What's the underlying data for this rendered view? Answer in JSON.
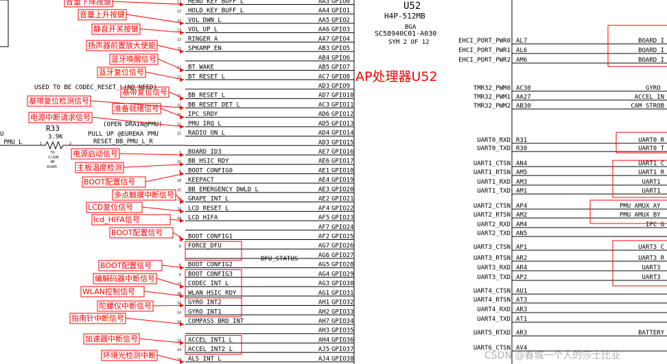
{
  "chip": {
    "ref": "U52",
    "part": "H4P-512MB",
    "package": "BGA",
    "number": "SC58940C01-A030",
    "sym": "SYM 2 OF 12",
    "title_annotation": "AP处理器U52"
  },
  "misc": {
    "used_note": "USED TO BE CODEC_RESET_L(NO NEED)",
    "open_drain": "(OPEN DRAIN@PMU)",
    "pull_up": "PULL UP @EUREKA PMU",
    "reset_net": "RESET_BB_PMU_L_R",
    "dfu_status": "DFU_STATUS",
    "left_u": "U",
    "left_net": "_PMU_L",
    "watermark": "CSDN @春城一个人的莎士比亚"
  },
  "resistor": {
    "ref": "R33",
    "value": "3.9K",
    "tol": "5%",
    "power": "1/32W",
    "type": "MF",
    "pkg": "01005",
    "pin1": "1",
    "pin2": "2"
  },
  "left_pins": [
    {
      "net": "MENU_KEY_BUFF_L",
      "ball": "AA3",
      "gpio": "GPIO0",
      "pin": "12"
    },
    {
      "net": "HOLD_KEY_BUFF_L",
      "ball": "AA4",
      "gpio": "GPIO1",
      "pin": "12"
    },
    {
      "net": "VOL_DWN_L",
      "ball": "AA5",
      "gpio": "GPIO2",
      "pin": "13"
    },
    {
      "net": "VOL_UP_L",
      "ball": "AA6",
      "gpio": "GPIO3",
      "pin": "13"
    },
    {
      "net": "RINGER_A",
      "ball": "AA7",
      "gpio": "GPIO4",
      "pin": "13"
    },
    {
      "net": "SPKAMP_EN",
      "ball": "AB3",
      "gpio": "GPIO5",
      "pin": "13"
    },
    {
      "net": "",
      "ball": "AB4",
      "gpio": "GPIO6",
      "pin": ""
    },
    {
      "net": "BT_WAKE",
      "ball": "AB5",
      "gpio": "GPIO7",
      "pin": "17"
    },
    {
      "net": "BT_RESET_L",
      "ball": "AC7",
      "gpio": "GPIO8",
      "pin": "17"
    },
    {
      "net": "",
      "ball": "AD3",
      "gpio": "GPIO9",
      "pin": ""
    },
    {
      "net": "BB_RESET_L",
      "ball": "AD7",
      "gpio": "GPIO10",
      "pin": "15"
    },
    {
      "net": "BB_RESET_DET_L",
      "ball": "AC3",
      "gpio": "GPIO11",
      "pin": "15"
    },
    {
      "net": "IPC_SRDY",
      "ball": "AD6",
      "gpio": "GPIO12",
      "pin": "15"
    },
    {
      "net": "PMU_IRQ_L",
      "ball": "AD5",
      "gpio": "GPIO13",
      "pin": "12"
    },
    {
      "net": "RADIO_ON_L",
      "ball": "AD4",
      "gpio": "GPIO14",
      "pin": "15"
    },
    {
      "net": "",
      "ball": "AD3",
      "gpio": "GPIO15",
      "pin": ""
    },
    {
      "net": "BOARD_ID3",
      "ball": "AE7",
      "gpio": "GPIO16",
      "pin": "1"
    },
    {
      "net": "BB_HSIC_RDY",
      "ball": "AE6",
      "gpio": "GPIO17",
      "pin": "15"
    },
    {
      "net": "BOOT_CONFIG0",
      "ball": "AE1",
      "gpio": "GPIO18",
      "pin": "6"
    },
    {
      "net": "KEEPACT",
      "ball": "AE4",
      "gpio": "GPIO19",
      "pin": "18"
    },
    {
      "net": "BB_EMERGENCY_DWLD_L",
      "ball": "AE3",
      "gpio": "GPIO20",
      "pin": "15"
    },
    {
      "net": "GRAPE_INT_L",
      "ball": "AE2",
      "gpio": "GPIO21",
      "pin": "14"
    },
    {
      "net": "LCD_RESET_L",
      "ball": "AF4",
      "gpio": "GPIO22",
      "pin": "14"
    },
    {
      "net": "LCD_HIFA",
      "ball": "AF5",
      "gpio": "GPIO23",
      "pin": "14"
    },
    {
      "net": "",
      "ball": "AF7",
      "gpio": "GPIO24",
      "pin": ""
    },
    {
      "net": "BOOT_CONFIG1",
      "ball": "AF2",
      "gpio": "GPIO25",
      "pin": "6"
    },
    {
      "net": "FORCE_DFU",
      "ball": "AG7",
      "gpio": "GPIO26",
      "pin": "6"
    },
    {
      "net": "",
      "ball": "AG6",
      "gpio": "GPIO27",
      "pin": ""
    },
    {
      "net": "BOOT_CONFIG2",
      "ball": "AG5",
      "gpio": "GPIO28",
      "pin": "6"
    },
    {
      "net": "BOOT_CONFIG3",
      "ball": "AG4",
      "gpio": "GPIO29",
      "pin": "6"
    },
    {
      "net": "CODEC_INT_L",
      "ball": "AG3",
      "gpio": "GPIO30",
      "pin": "23"
    },
    {
      "net": "WLAN_HSIC_RDY",
      "ball": "AG1",
      "gpio": "GPIO31",
      "pin": "28"
    },
    {
      "net": "GYRO_INT2",
      "ball": "AH1",
      "gpio": "GPIO32",
      "pin": "14"
    },
    {
      "net": "GYRO_INT1",
      "ball": "AH2",
      "gpio": "GPIO33",
      "pin": "14"
    },
    {
      "net": "COMPASS_BRD_INT",
      "ball": "AH7",
      "gpio": "GPIO34",
      "pin": "14"
    },
    {
      "net": "",
      "ball": "AH3",
      "gpio": "GPIO35",
      "pin": ""
    },
    {
      "net": "ACCEL_INT1_L",
      "ball": "AH4",
      "gpio": "GPIO36",
      "pin": "14"
    },
    {
      "net": "ACCEL_INT2_L",
      "ball": "AJ5",
      "gpio": "GPIO37",
      "pin": "14"
    },
    {
      "net": "ALS_INT_L",
      "ball": "AJ4",
      "gpio": "GPIO38",
      "pin": "14"
    }
  ],
  "annotations_left": [
    "音量下降按键",
    "音量上升按键",
    "静音开关按键",
    "扬声器前置放大使能",
    "蓝牙唤醒信号",
    "蓝牙复位信号",
    "基带复位信号",
    "基带复位检测信号",
    "准备就绪信号",
    "电源中断请求信号",
    "电源启动信号",
    "主板温度检测",
    "BOOT配置信号",
    "多点触摸中断信号",
    "LCD复位信号",
    "lcd_HIFA信号",
    "BOOT配置信号",
    "BOOT配置信号",
    "编解码器中断信号",
    "WLAN控制信号",
    "陀螺仪中断信号",
    "指南针中断信号",
    "加速器中断信号",
    "环境光检测中断"
  ],
  "right_pins": [
    {
      "name": "EHCI_PORT_PWR0",
      "ball": "AL7",
      "net": "BOARD_I"
    },
    {
      "name": "EHCI_PORT_PWR1",
      "ball": "AL6",
      "net": "BOARD_I"
    },
    {
      "name": "EHCI_PORT_PWR2",
      "ball": "AM6",
      "net": "BOARD_I"
    },
    {
      "name": "TMR32_PWM0",
      "ball": "AC30",
      "net": "GYRO_"
    },
    {
      "name": "TMR32_PWM1",
      "ball": "AA27",
      "net": "ACCEL_IN"
    },
    {
      "name": "TMR32_PWM2",
      "ball": "AB30",
      "net": "CAM_STROB"
    },
    {
      "name": "UART0_RXD",
      "ball": "R31",
      "net": "UART0_R"
    },
    {
      "name": "UART0_TXD",
      "ball": "R30",
      "net": "UART0_T"
    },
    {
      "name": "UART1_CTSN",
      "ball": "AN4",
      "net": "UART1_C"
    },
    {
      "name": "UART1_RTSN",
      "ball": "AM5",
      "net": "UART1_R"
    },
    {
      "name": "UART1_RXD",
      "ball": "AM3",
      "net": "UART1_"
    },
    {
      "name": "UART1_TXD",
      "ball": "AM1",
      "net": "UART1_"
    },
    {
      "name": "UART2_CTSN",
      "ball": "AP4",
      "net": "PMU_AMUX_AY_"
    },
    {
      "name": "UART2_RTSN",
      "ball": "AM2",
      "net": "PMU_AMUX_BY_"
    },
    {
      "name": "UART2_RXD",
      "ball": "AM4",
      "net": "IPC_G"
    },
    {
      "name": "UART2_TXD",
      "ball": "AN5",
      "net": ""
    },
    {
      "name": "UART3_CTSN",
      "ball": "AP1",
      "net": "UART3_C"
    },
    {
      "name": "UART3_RTSN",
      "ball": "AR2",
      "net": "UART3_R"
    },
    {
      "name": "UART3_RXD",
      "ball": "AR4",
      "net": "UART3_"
    },
    {
      "name": "UART3_TXD",
      "ball": "AP2",
      "net": "UART3_"
    },
    {
      "name": "UART4_CTSN",
      "ball": "AU1",
      "net": ""
    },
    {
      "name": "UART4_RTSN",
      "ball": "AT3",
      "net": ""
    },
    {
      "name": "UART4_RXD",
      "ball": "AR3",
      "net": ""
    },
    {
      "name": "UART4_TXD",
      "ball": "AT1",
      "net": ""
    },
    {
      "name": "UART5_RTXD",
      "ball": "AR3",
      "net": "BATTERY"
    },
    {
      "name": "UART6_CTSN",
      "ball": "AV4",
      "net": ""
    }
  ]
}
